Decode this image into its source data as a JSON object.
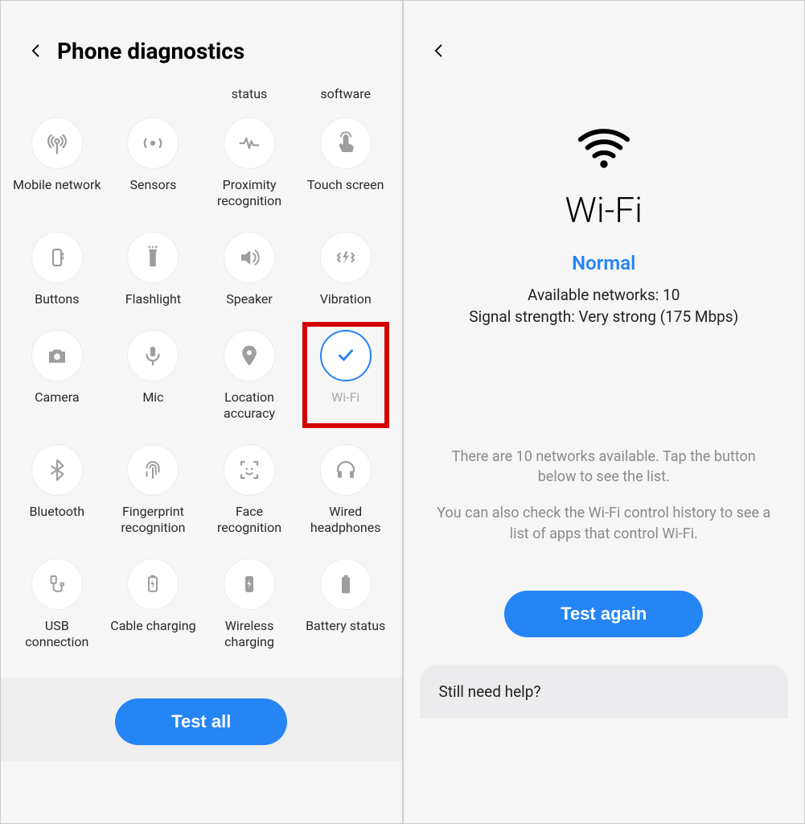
{
  "left": {
    "title": "Phone diagnostics",
    "partial_labels": [
      "",
      "",
      "status",
      "software"
    ],
    "rows": [
      [
        {
          "icon": "network",
          "label": "Mobile network"
        },
        {
          "icon": "sensors",
          "label": "Sensors"
        },
        {
          "icon": "proximity",
          "label": "Proximity recognition"
        },
        {
          "icon": "touch",
          "label": "Touch screen"
        }
      ],
      [
        {
          "icon": "buttons",
          "label": "Buttons"
        },
        {
          "icon": "flashlight",
          "label": "Flashlight"
        },
        {
          "icon": "speaker",
          "label": "Speaker"
        },
        {
          "icon": "vibration",
          "label": "Vibration"
        }
      ],
      [
        {
          "icon": "camera",
          "label": "Camera"
        },
        {
          "icon": "mic",
          "label": "Mic"
        },
        {
          "icon": "location",
          "label": "Location accuracy"
        },
        {
          "icon": "wifi",
          "label": "Wi-Fi",
          "checked": true,
          "highlighted": true,
          "muted": true
        }
      ],
      [
        {
          "icon": "bluetooth",
          "label": "Bluetooth"
        },
        {
          "icon": "fingerprint",
          "label": "Fingerprint recognition"
        },
        {
          "icon": "face",
          "label": "Face recognition"
        },
        {
          "icon": "headphones",
          "label": "Wired headphones"
        }
      ],
      [
        {
          "icon": "usb",
          "label": "USB connection"
        },
        {
          "icon": "cable",
          "label": "Cable charging"
        },
        {
          "icon": "wireless",
          "label": "Wireless charging"
        },
        {
          "icon": "battery",
          "label": "Battery status"
        }
      ]
    ],
    "test_all": "Test all"
  },
  "right": {
    "title": "Wi-Fi",
    "status": "Normal",
    "info1": "Available networks: 10",
    "info2": "Signal strength: Very strong (175 Mbps)",
    "hint1": "There are 10 networks available. Tap the button below to see the list.",
    "hint2": "You can also check the Wi-Fi control history to see a list of apps that control Wi-Fi.",
    "test_again": "Test again",
    "help": "Still need help?"
  }
}
